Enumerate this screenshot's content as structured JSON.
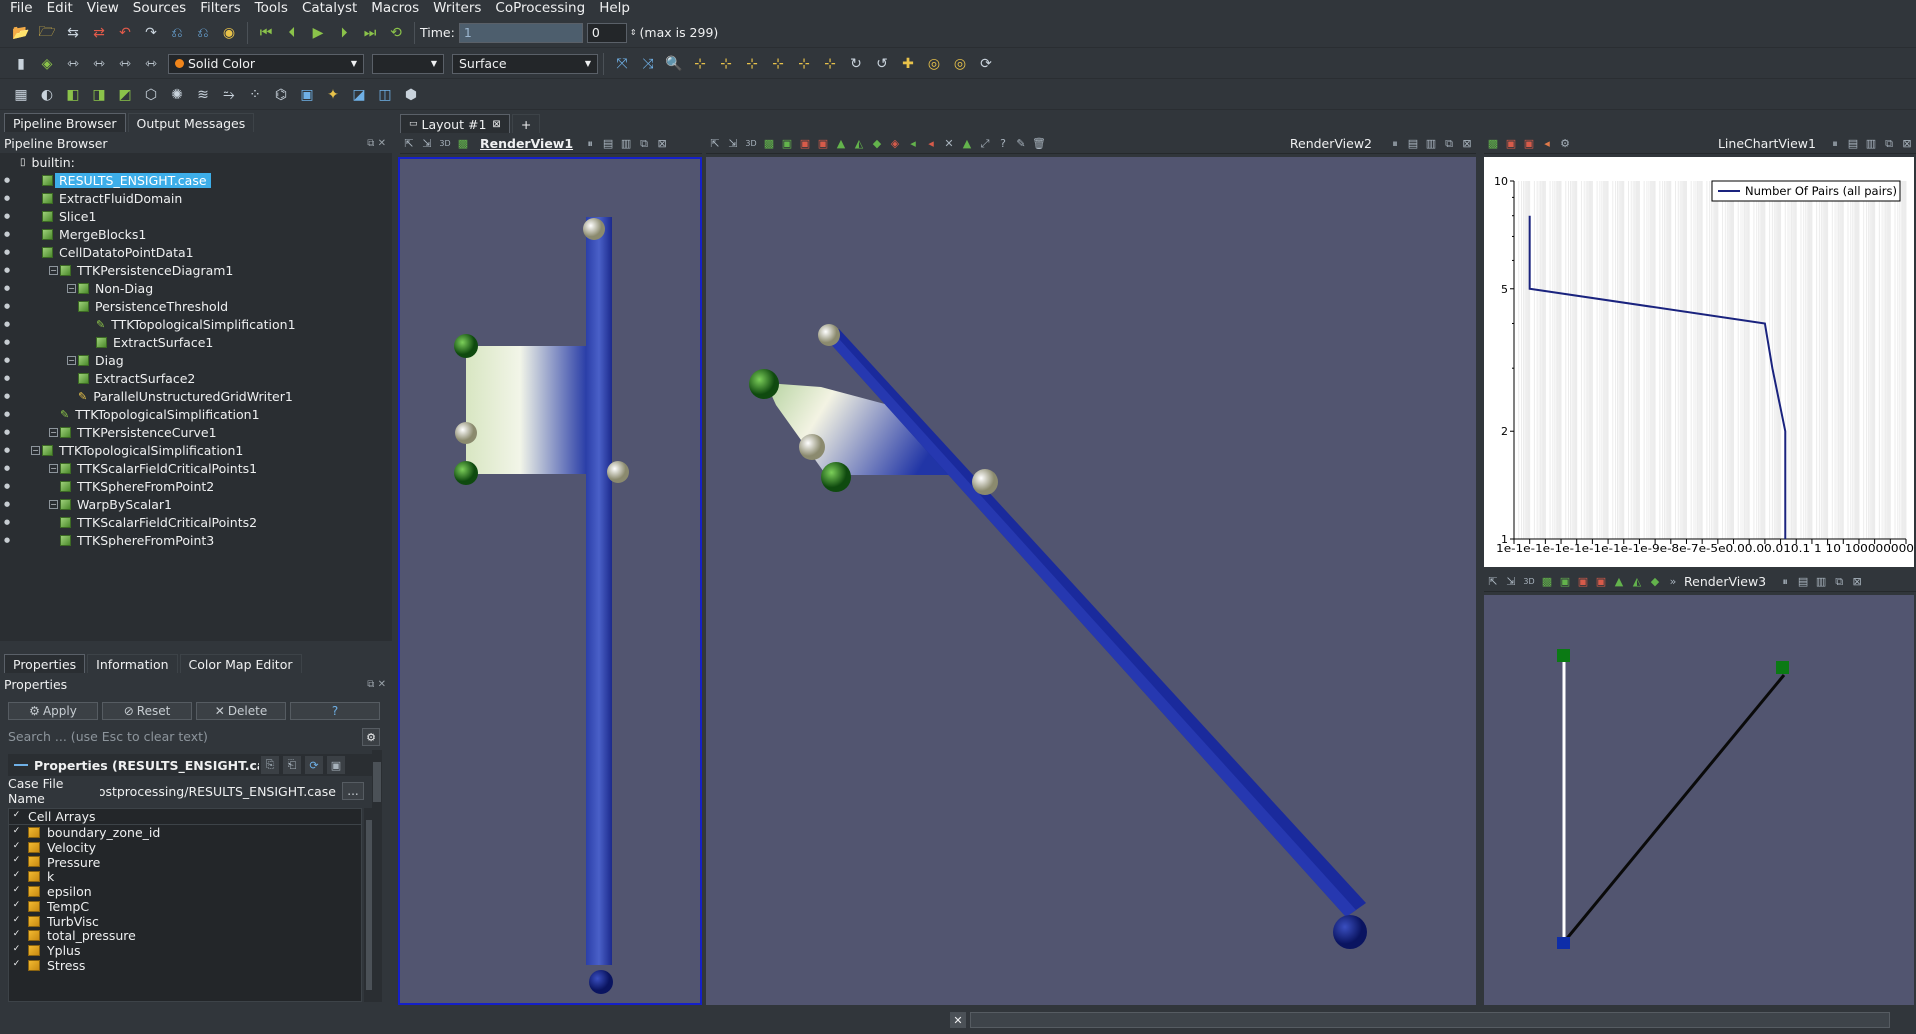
{
  "menu": [
    "File",
    "Edit",
    "View",
    "Sources",
    "Filters",
    "Tools",
    "Catalyst",
    "Macros",
    "Writers",
    "CoProcessing",
    "Help"
  ],
  "time": {
    "label": "Time:",
    "value": "1",
    "step": "0",
    "max": "(max is 299)"
  },
  "toolbar2": {
    "color_mode": "Solid Color",
    "second_combo": "",
    "representation": "Surface"
  },
  "left_tabs": [
    "Pipeline Browser",
    "Output Messages"
  ],
  "pipeline": {
    "title": "Pipeline Browser",
    "builtin": "builtin:",
    "items": [
      {
        "label": "RESULTS_ENSIGHT.case",
        "indent": 0,
        "selected": true
      },
      {
        "label": "ExtractFluidDomain",
        "indent": 0
      },
      {
        "label": "Slice1",
        "indent": 0
      },
      {
        "label": "MergeBlocks1",
        "indent": 0
      },
      {
        "label": "CellDatatoPointData1",
        "indent": 0
      },
      {
        "label": "TTKPersistenceDiagram1",
        "indent": 1,
        "expander": true
      },
      {
        "label": "Non-Diag",
        "indent": 2,
        "expander": true
      },
      {
        "label": "PersistenceThreshold",
        "indent": 2
      },
      {
        "label": "TTKTopologicalSimplification1",
        "indent": 3,
        "pencil": true
      },
      {
        "label": "ExtractSurface1",
        "indent": 3
      },
      {
        "label": "Diag",
        "indent": 2,
        "expander": true
      },
      {
        "label": "ExtractSurface2",
        "indent": 2
      },
      {
        "label": "ParallelUnstructuredGridWriter1",
        "indent": 2,
        "writer": true
      },
      {
        "label": "TTKTopologicalSimplification1",
        "indent": 1,
        "pencil": true
      },
      {
        "label": "TTKPersistenceCurve1",
        "indent": 1,
        "expander": true
      },
      {
        "label": "TTKTopologicalSimplification1",
        "indent": 0,
        "expander": true
      },
      {
        "label": "TTKScalarFieldCriticalPoints1",
        "indent": 1,
        "expander": true
      },
      {
        "label": "TTKSphereFromPoint2",
        "indent": 1
      },
      {
        "label": "WarpByScalar1",
        "indent": 1,
        "expander": true
      },
      {
        "label": "TTKScalarFieldCriticalPoints2",
        "indent": 1
      },
      {
        "label": "TTKSphereFromPoint3",
        "indent": 1
      }
    ]
  },
  "prop_tabs": [
    "Properties",
    "Information",
    "Color Map Editor"
  ],
  "properties": {
    "title": "Properties",
    "apply": "Apply",
    "reset": "Reset",
    "delete": "Delete",
    "help": "?",
    "search_placeholder": "Search ... (use Esc to clear text)",
    "section": "Properties (RESULTS_ENSIGHT.ca:",
    "case_label": "Case File Name",
    "case_value": "ostprocessing/RESULTS_ENSIGHT.case",
    "browse": "...",
    "cell_arrays_label": "Cell Arrays",
    "cell_arrays": [
      "boundary_zone_id",
      "Velocity",
      "Pressure",
      "k",
      "epsilon",
      "TempC",
      "TurbVisc",
      "total_pressure",
      "Yplus",
      "Stress"
    ]
  },
  "layout_tab": "Layout #1",
  "views": {
    "rv1": "RenderView1",
    "rv2": "RenderView2",
    "chart": "LineChartView1",
    "rv3": "RenderView3"
  },
  "chart_data": {
    "type": "line",
    "legend": "Number Of Pairs (all pairs)",
    "legend_placement": "top-right",
    "x_scale": "log",
    "y_scale": "log",
    "ylim": [
      1,
      10
    ],
    "y_ticks": [
      "10",
      "5",
      "2",
      "1"
    ],
    "x_tick_text": "1e-1e-1e-1e-1e-1e-1e-1e-9e-8e-7e-5e0.00.00.010.1 1 10 100000000",
    "series": [
      {
        "name": "Number Of Pairs (all pairs)",
        "color": "#1a237e",
        "points": [
          [
            1e-15,
            8
          ],
          [
            1e-15,
            5
          ],
          [
            1,
            4
          ],
          [
            3,
            3
          ],
          [
            20,
            2
          ],
          [
            20,
            1
          ]
        ]
      }
    ]
  }
}
